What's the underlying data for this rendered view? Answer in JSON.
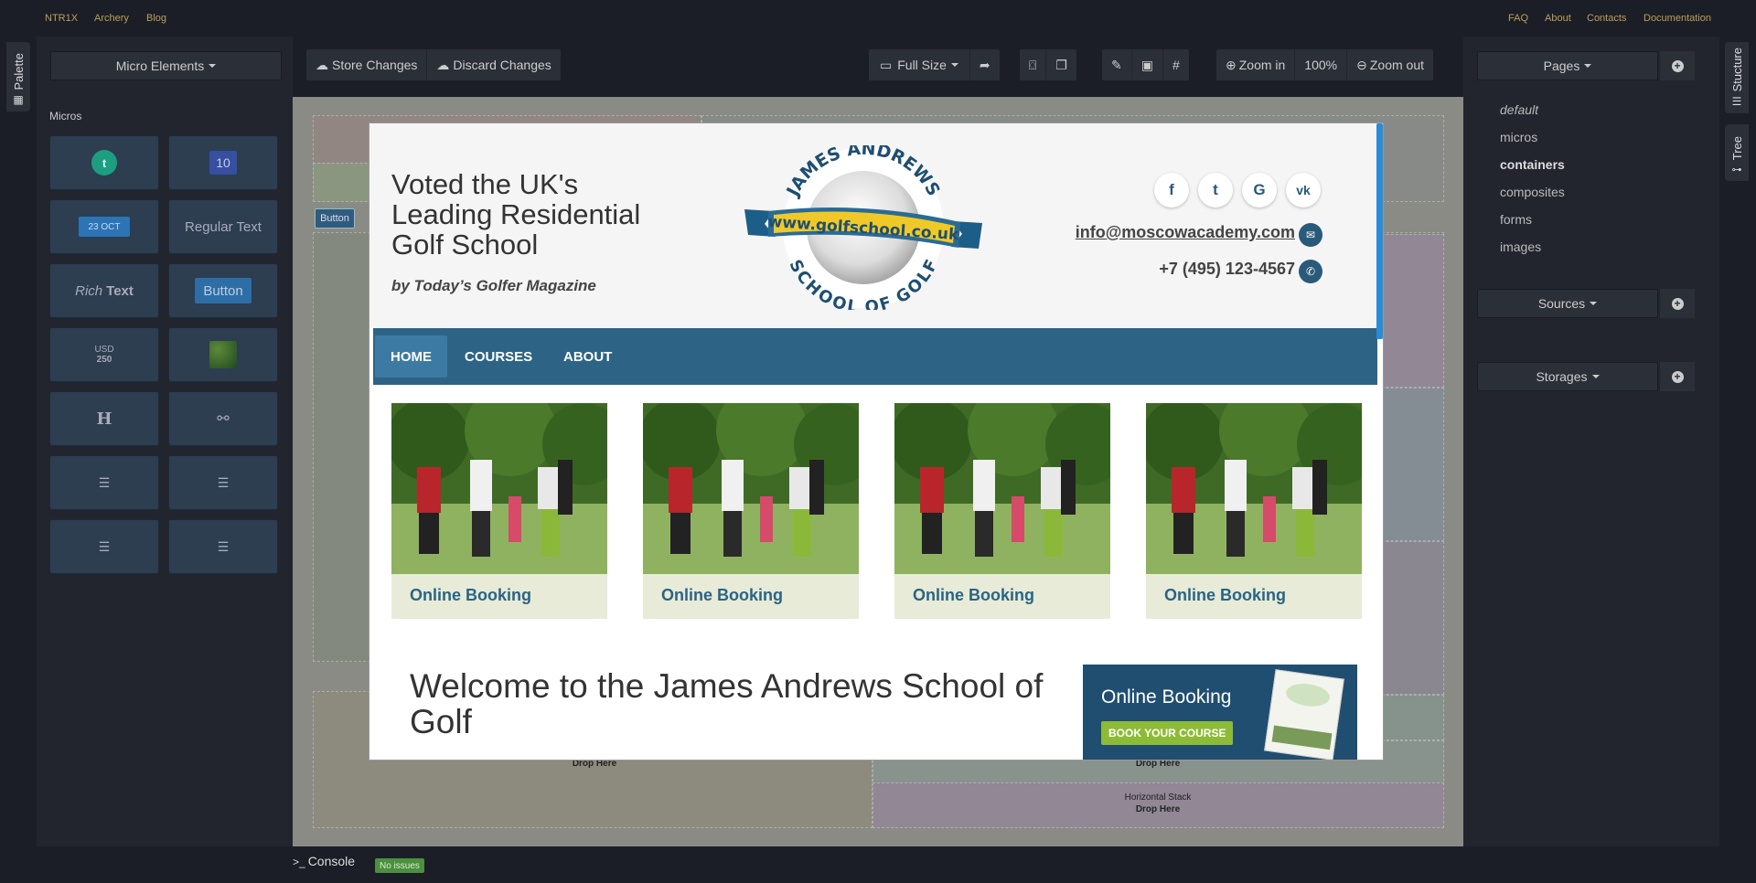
{
  "topnav": {
    "left": [
      "NTR1X",
      "Archery",
      "Blog"
    ],
    "right": [
      "FAQ",
      "About",
      "Contacts",
      "Documentation"
    ]
  },
  "rails": {
    "palette": "Palette",
    "structure": "Stucture",
    "tree": "Tree"
  },
  "left_panel": {
    "dropdown": "Micro Elements",
    "section": "Micros",
    "tiles": {
      "counter": "10",
      "date": "23 OCT",
      "regular_text": "Regular Text",
      "rich_1": "Rich",
      "rich_2": "Text",
      "button": "Button",
      "currency_1": "USD",
      "currency_2": "250",
      "heading": "H"
    }
  },
  "toolbar": {
    "store": "Store Changes",
    "discard": "Discard Changes",
    "size": "Full Size",
    "zoom_in": "Zoom in",
    "zoom_level": "100%",
    "zoom_out": "Zoom out"
  },
  "canvas": {
    "button_chip": "Button",
    "drop_here": "Drop Here",
    "horizontal_stack": "Horizontal Stack"
  },
  "modal": {
    "tagline": "Voted the UK's Leading Residential Golf School",
    "byline": "by Today’s Golfer Magazine",
    "logo": {
      "top": "JAMES ANDREWS",
      "ribbon": "www.golfschool.co.uk",
      "bottom": "SCHOOL OF GOLF"
    },
    "social": [
      "f",
      "t",
      "G",
      "vk"
    ],
    "email": "info@moscowacademy.com",
    "phone": "+7 (495) 123-4567",
    "nav": [
      "HOME",
      "COURSES",
      "ABOUT"
    ],
    "cards": [
      "Online Booking",
      "Online Booking",
      "Online Booking",
      "Online Booking"
    ],
    "welcome": "Welcome to the James Andrews School of Golf",
    "booking": {
      "title": "Online Booking",
      "button": "BOOK YOUR COURSE"
    }
  },
  "right_panel": {
    "pages_dropdown": "Pages",
    "pages": [
      "default",
      "micros",
      "containers",
      "composites",
      "forms",
      "images"
    ],
    "sources_dropdown": "Sources",
    "storages_dropdown": "Storages"
  },
  "console": {
    "label": "Console",
    "status": "No issues"
  }
}
